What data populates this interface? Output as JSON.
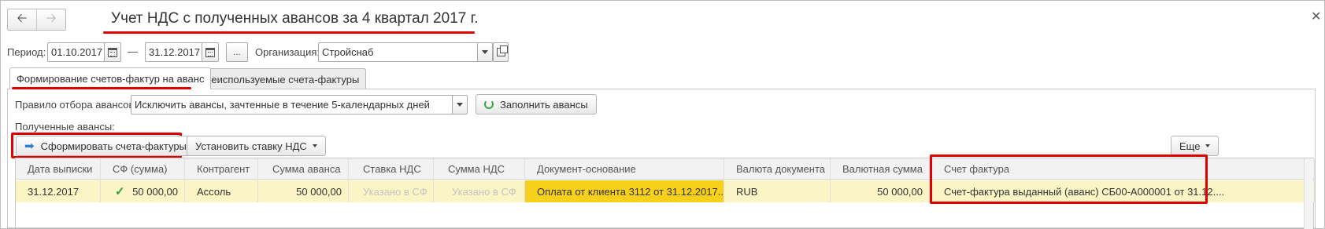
{
  "header": {
    "title": "Учет НДС с полученных авансов за 4 квартал 2017 г.",
    "back_icon": "arrow-left-icon",
    "forward_icon": "arrow-right-icon",
    "close_icon": "close-icon"
  },
  "filters": {
    "period_label": "Период:",
    "date_from": "01.10.2017",
    "dash": "—",
    "date_to": "31.12.2017",
    "more_button": "...",
    "org_label": "Организация:",
    "org_value": "Стройснаб"
  },
  "tabs": [
    {
      "label": "Формирование счетов-фактур на аванс",
      "active": true
    },
    {
      "label": "Неиспользуемые счета-фактуры",
      "active": false
    }
  ],
  "rule": {
    "label": "Правило отбора авансов:",
    "value": "Исключить авансы, зачтенные в течение 5-календарных дней",
    "fill_button": "Заполнить авансы"
  },
  "advances": {
    "label": "Полученные авансы:",
    "form_button": "Сформировать счета-фактуры",
    "vat_button": "Установить ставку НДС",
    "more_button": "Еще"
  },
  "table": {
    "columns": [
      "Дата выписки",
      "СФ (сумма)",
      "Контрагент",
      "Сумма аванса",
      "Ставка НДС",
      "Сумма НДС",
      "Документ-основание",
      "Валюта документа",
      "Валютная сумма",
      "Счет фактура"
    ],
    "rows": [
      {
        "date": "31.12.2017",
        "sf_amount": "50 000,00",
        "contractor": "Ассоль",
        "advance_amount": "50 000,00",
        "vat_rate": "Указано в СФ",
        "vat_amount": "Указано в СФ",
        "base_document": "Оплата от клиента 3112 от 31.12.2017...",
        "currency": "RUB",
        "currency_amount": "50 000,00",
        "invoice": "Счет-фактура выданный (аванс) СБ00-А000001 от 31.12...."
      }
    ]
  },
  "colors": {
    "highlight_red": "#e00000",
    "row_yellow": "#fbf5c6",
    "cell_yellow": "#f7d01c",
    "check_green": "#2e9e3f"
  }
}
